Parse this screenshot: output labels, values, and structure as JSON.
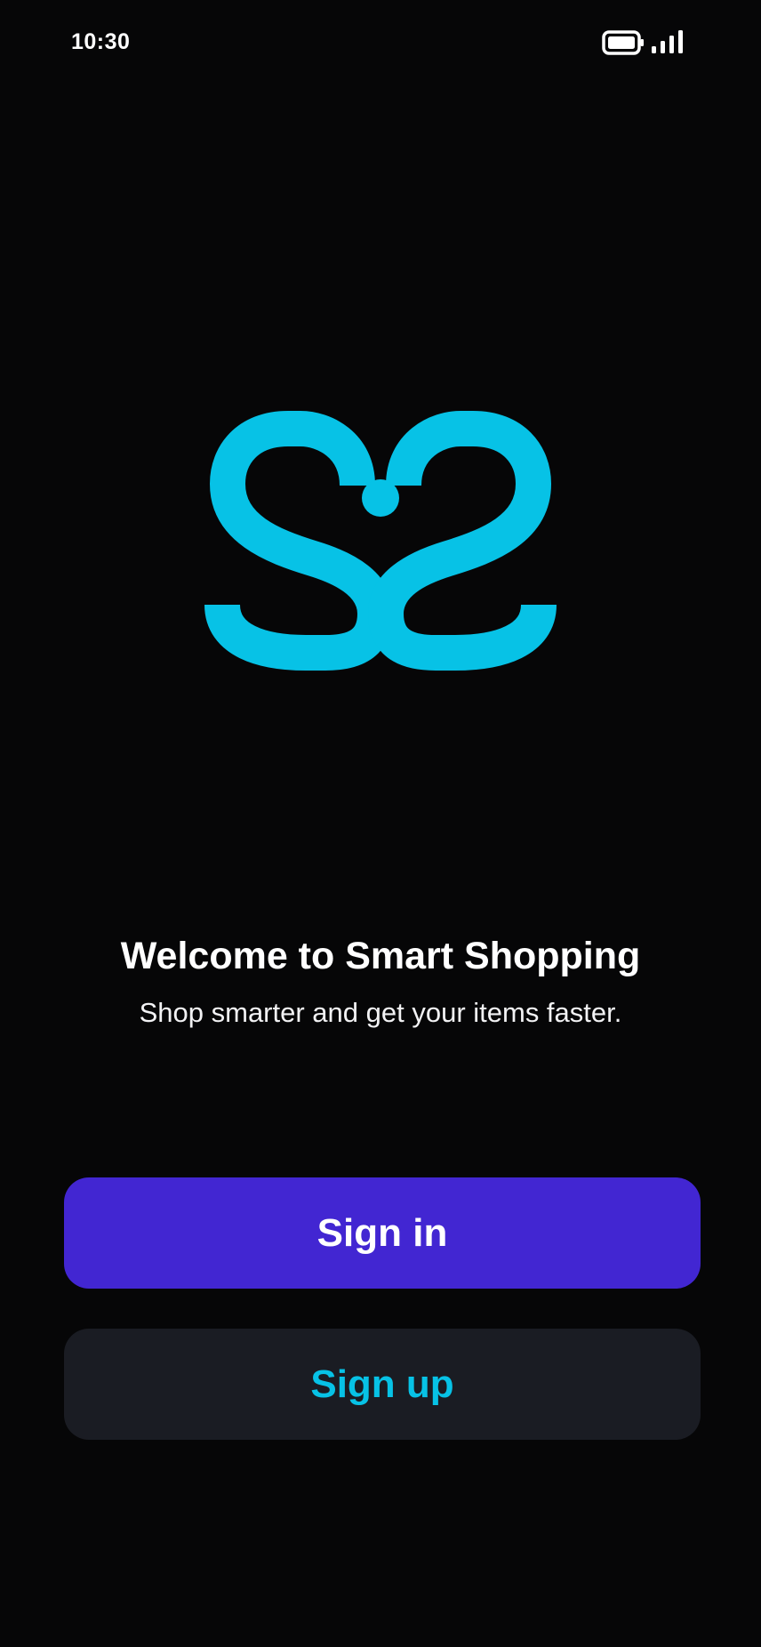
{
  "status_bar": {
    "time": "10:30",
    "battery_icon": "battery-full-icon",
    "signal_icon": "signal-bars-icon"
  },
  "logo": {
    "icon": "smart-shopping-logo-icon",
    "color": "#07c2e6"
  },
  "welcome": {
    "title": "Welcome to Smart Shopping",
    "subtitle": "Shop smarter and get your items faster."
  },
  "actions": {
    "sign_in_label": "Sign in",
    "sign_up_label": "Sign up"
  },
  "colors": {
    "background": "#060607",
    "primary": "#4226d2",
    "secondary_button": "#1a1c23",
    "accent": "#07c2e6",
    "text": "#ffffff"
  }
}
